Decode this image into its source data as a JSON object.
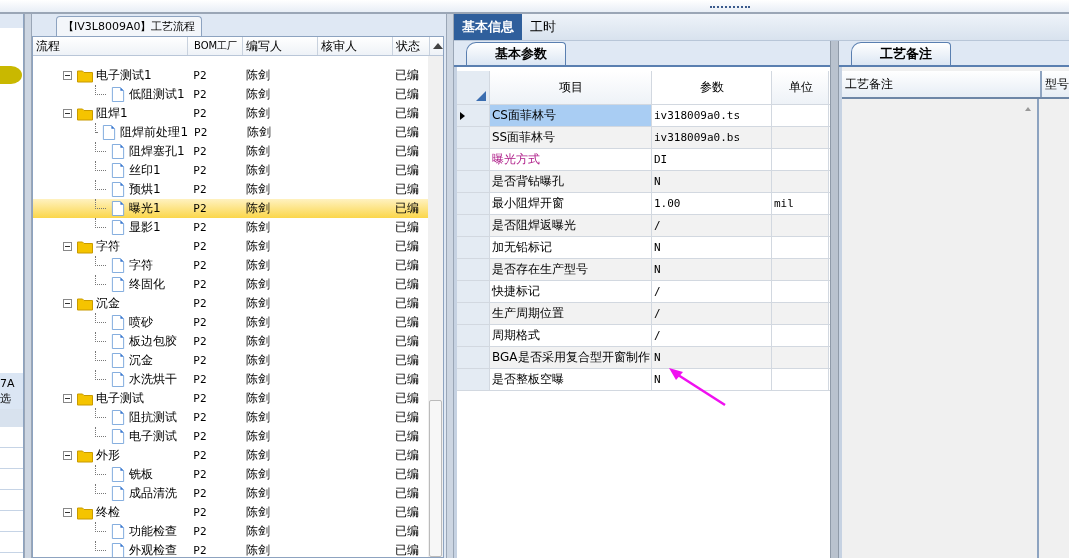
{
  "left_strip": {
    "tab_lines": [
      "7A",
      "选"
    ]
  },
  "flow_panel": {
    "title": "【IV3L8009A0】工艺流程",
    "columns": [
      "流程",
      "BOM工厂",
      "编写人",
      "核审人",
      "状态"
    ],
    "tree": [
      {
        "name": "电子测试1",
        "bom": "P2",
        "writer": "陈剑",
        "status": "已编",
        "selected": false,
        "children": [
          {
            "name": "低阻测试1",
            "bom": "P2",
            "writer": "陈剑",
            "status": "已编",
            "selected": false
          }
        ]
      },
      {
        "name": "阻焊1",
        "bom": "P2",
        "writer": "陈剑",
        "status": "已编",
        "selected": false,
        "children": [
          {
            "name": "阻焊前处理1",
            "bom": "P2",
            "writer": "陈剑",
            "status": "已编",
            "selected": false
          },
          {
            "name": "阻焊塞孔1",
            "bom": "P2",
            "writer": "陈剑",
            "status": "已编",
            "selected": false
          },
          {
            "name": "丝印1",
            "bom": "P2",
            "writer": "陈剑",
            "status": "已编",
            "selected": false
          },
          {
            "name": "预烘1",
            "bom": "P2",
            "writer": "陈剑",
            "status": "已编",
            "selected": false
          },
          {
            "name": "曝光1",
            "bom": "P2",
            "writer": "陈剑",
            "status": "已编",
            "selected": true
          },
          {
            "name": "显影1",
            "bom": "P2",
            "writer": "陈剑",
            "status": "已编",
            "selected": false
          }
        ]
      },
      {
        "name": "字符",
        "bom": "P2",
        "writer": "陈剑",
        "status": "已编",
        "selected": false,
        "children": [
          {
            "name": "字符",
            "bom": "P2",
            "writer": "陈剑",
            "status": "已编",
            "selected": false
          },
          {
            "name": "终固化",
            "bom": "P2",
            "writer": "陈剑",
            "status": "已编",
            "selected": false
          }
        ]
      },
      {
        "name": "沉金",
        "bom": "P2",
        "writer": "陈剑",
        "status": "已编",
        "selected": false,
        "children": [
          {
            "name": "喷砂",
            "bom": "P2",
            "writer": "陈剑",
            "status": "已编",
            "selected": false
          },
          {
            "name": "板边包胶",
            "bom": "P2",
            "writer": "陈剑",
            "status": "已编",
            "selected": false
          },
          {
            "name": "沉金",
            "bom": "P2",
            "writer": "陈剑",
            "status": "已编",
            "selected": false
          },
          {
            "name": "水洗烘干",
            "bom": "P2",
            "writer": "陈剑",
            "status": "已编",
            "selected": false
          }
        ]
      },
      {
        "name": "电子测试",
        "bom": "P2",
        "writer": "陈剑",
        "status": "已编",
        "selected": false,
        "children": [
          {
            "name": "阻抗测试",
            "bom": "P2",
            "writer": "陈剑",
            "status": "已编",
            "selected": false
          },
          {
            "name": "电子测试",
            "bom": "P2",
            "writer": "陈剑",
            "status": "已编",
            "selected": false
          }
        ]
      },
      {
        "name": "外形",
        "bom": "P2",
        "writer": "陈剑",
        "status": "已编",
        "selected": false,
        "children": [
          {
            "name": "铣板",
            "bom": "P2",
            "writer": "陈剑",
            "status": "已编",
            "selected": false
          },
          {
            "name": "成品清洗",
            "bom": "P2",
            "writer": "陈剑",
            "status": "已编",
            "selected": false
          }
        ]
      },
      {
        "name": "终检",
        "bom": "P2",
        "writer": "陈剑",
        "status": "已编",
        "selected": false,
        "children": [
          {
            "name": "功能检查",
            "bom": "P2",
            "writer": "陈剑",
            "status": "已编",
            "selected": false
          },
          {
            "name": "外观检查",
            "bom": "P2",
            "writer": "陈剑",
            "status": "已编",
            "selected": false
          }
        ]
      }
    ]
  },
  "info_panel": {
    "tabs": [
      {
        "label": "基本信息",
        "selected": true
      },
      {
        "label": "工时",
        "selected": false
      }
    ],
    "subtab": "基本参数",
    "columns": [
      "项目",
      "参数",
      "单位"
    ],
    "rows": [
      {
        "item": "CS面菲林号",
        "value": "iv318009a0.ts",
        "unit": "",
        "selected": true,
        "emphasis": false
      },
      {
        "item": "SS面菲林号",
        "value": "iv318009a0.bs",
        "unit": "",
        "selected": false,
        "emphasis": false
      },
      {
        "item": "曝光方式",
        "value": "DI",
        "unit": "",
        "selected": false,
        "emphasis": true
      },
      {
        "item": "是否背钻曝孔",
        "value": "N",
        "unit": "",
        "selected": false,
        "emphasis": false
      },
      {
        "item": "最小阻焊开窗",
        "value": "1.00",
        "unit": "mil",
        "selected": false,
        "emphasis": false
      },
      {
        "item": "是否阻焊返曝光",
        "value": "/",
        "unit": "",
        "selected": false,
        "emphasis": false
      },
      {
        "item": "加无铅标记",
        "value": "N",
        "unit": "",
        "selected": false,
        "emphasis": false
      },
      {
        "item": "是否存在生产型号",
        "value": "N",
        "unit": "",
        "selected": false,
        "emphasis": false
      },
      {
        "item": "快捷标记",
        "value": "/",
        "unit": "",
        "selected": false,
        "emphasis": false
      },
      {
        "item": "生产周期位置",
        "value": "/",
        "unit": "",
        "selected": false,
        "emphasis": false
      },
      {
        "item": "周期格式",
        "value": "/",
        "unit": "",
        "selected": false,
        "emphasis": false
      },
      {
        "item": "BGA是否采用复合型开窗制作",
        "value": "N",
        "unit": "",
        "selected": false,
        "emphasis": false
      },
      {
        "item": "是否整板空曝",
        "value": "N",
        "unit": "",
        "selected": false,
        "emphasis": false
      }
    ]
  },
  "notes_panel": {
    "tab": "工艺备注",
    "columns": [
      "工艺备注",
      "型号"
    ]
  }
}
